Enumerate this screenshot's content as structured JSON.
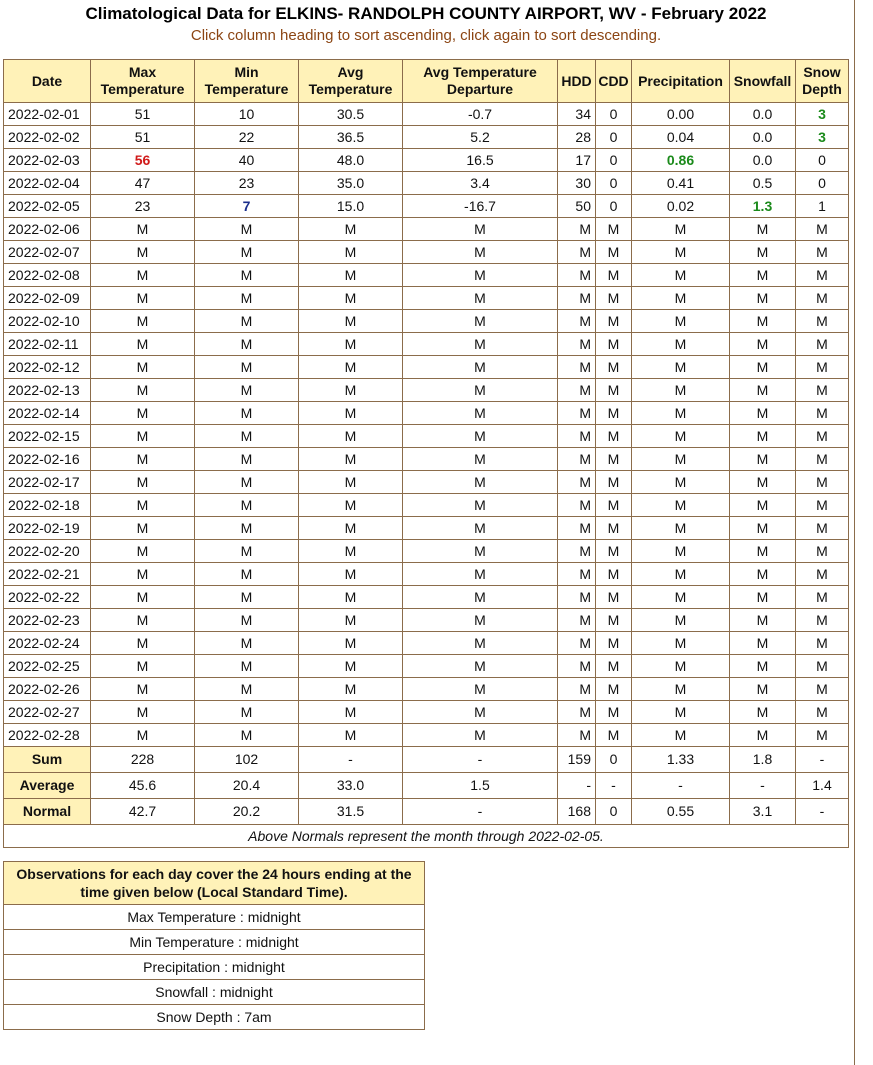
{
  "page": {
    "title": "Climatological Data for ELKINS- RANDOLPH COUNTY AIRPORT, WV - February 2022",
    "subtitle": "Click column heading to sort ascending, click again to sort descending."
  },
  "colors": {
    "header_bg": "#fff2b8",
    "border": "#8b6c4b",
    "subtitle": "#8b4513",
    "record_high": "#d11a1a",
    "record_low": "#1a2e8c",
    "max_green": "#1b8a1b"
  },
  "table": {
    "headers": [
      {
        "key": "date",
        "label": "Date"
      },
      {
        "key": "max",
        "label": "Max Temperature"
      },
      {
        "key": "min",
        "label": "Min Temperature"
      },
      {
        "key": "avg",
        "label": "Avg Temperature"
      },
      {
        "key": "dep",
        "label": "Avg Temperature Departure"
      },
      {
        "key": "hdd",
        "label": "HDD"
      },
      {
        "key": "cdd",
        "label": "CDD"
      },
      {
        "key": "precip",
        "label": "Precipitation"
      },
      {
        "key": "snow",
        "label": "Snowfall"
      },
      {
        "key": "depth",
        "label": "Snow Depth"
      }
    ],
    "rows": [
      [
        "2022-02-01",
        "51",
        "10",
        "30.5",
        "-0.7",
        "34",
        "0",
        "0.00",
        "0.0",
        "3"
      ],
      [
        "2022-02-02",
        "51",
        "22",
        "36.5",
        "5.2",
        "28",
        "0",
        "0.04",
        "0.0",
        "3"
      ],
      [
        "2022-02-03",
        "56",
        "40",
        "48.0",
        "16.5",
        "17",
        "0",
        "0.86",
        "0.0",
        "0"
      ],
      [
        "2022-02-04",
        "47",
        "23",
        "35.0",
        "3.4",
        "30",
        "0",
        "0.41",
        "0.5",
        "0"
      ],
      [
        "2022-02-05",
        "23",
        "7",
        "15.0",
        "-16.7",
        "50",
        "0",
        "0.02",
        "1.3",
        "1"
      ],
      [
        "2022-02-06",
        "M",
        "M",
        "M",
        "M",
        "M",
        "M",
        "M",
        "M",
        "M"
      ],
      [
        "2022-02-07",
        "M",
        "M",
        "M",
        "M",
        "M",
        "M",
        "M",
        "M",
        "M"
      ],
      [
        "2022-02-08",
        "M",
        "M",
        "M",
        "M",
        "M",
        "M",
        "M",
        "M",
        "M"
      ],
      [
        "2022-02-09",
        "M",
        "M",
        "M",
        "M",
        "M",
        "M",
        "M",
        "M",
        "M"
      ],
      [
        "2022-02-10",
        "M",
        "M",
        "M",
        "M",
        "M",
        "M",
        "M",
        "M",
        "M"
      ],
      [
        "2022-02-11",
        "M",
        "M",
        "M",
        "M",
        "M",
        "M",
        "M",
        "M",
        "M"
      ],
      [
        "2022-02-12",
        "M",
        "M",
        "M",
        "M",
        "M",
        "M",
        "M",
        "M",
        "M"
      ],
      [
        "2022-02-13",
        "M",
        "M",
        "M",
        "M",
        "M",
        "M",
        "M",
        "M",
        "M"
      ],
      [
        "2022-02-14",
        "M",
        "M",
        "M",
        "M",
        "M",
        "M",
        "M",
        "M",
        "M"
      ],
      [
        "2022-02-15",
        "M",
        "M",
        "M",
        "M",
        "M",
        "M",
        "M",
        "M",
        "M"
      ],
      [
        "2022-02-16",
        "M",
        "M",
        "M",
        "M",
        "M",
        "M",
        "M",
        "M",
        "M"
      ],
      [
        "2022-02-17",
        "M",
        "M",
        "M",
        "M",
        "M",
        "M",
        "M",
        "M",
        "M"
      ],
      [
        "2022-02-18",
        "M",
        "M",
        "M",
        "M",
        "M",
        "M",
        "M",
        "M",
        "M"
      ],
      [
        "2022-02-19",
        "M",
        "M",
        "M",
        "M",
        "M",
        "M",
        "M",
        "M",
        "M"
      ],
      [
        "2022-02-20",
        "M",
        "M",
        "M",
        "M",
        "M",
        "M",
        "M",
        "M",
        "M"
      ],
      [
        "2022-02-21",
        "M",
        "M",
        "M",
        "M",
        "M",
        "M",
        "M",
        "M",
        "M"
      ],
      [
        "2022-02-22",
        "M",
        "M",
        "M",
        "M",
        "M",
        "M",
        "M",
        "M",
        "M"
      ],
      [
        "2022-02-23",
        "M",
        "M",
        "M",
        "M",
        "M",
        "M",
        "M",
        "M",
        "M"
      ],
      [
        "2022-02-24",
        "M",
        "M",
        "M",
        "M",
        "M",
        "M",
        "M",
        "M",
        "M"
      ],
      [
        "2022-02-25",
        "M",
        "M",
        "M",
        "M",
        "M",
        "M",
        "M",
        "M",
        "M"
      ],
      [
        "2022-02-26",
        "M",
        "M",
        "M",
        "M",
        "M",
        "M",
        "M",
        "M",
        "M"
      ],
      [
        "2022-02-27",
        "M",
        "M",
        "M",
        "M",
        "M",
        "M",
        "M",
        "M",
        "M"
      ],
      [
        "2022-02-28",
        "M",
        "M",
        "M",
        "M",
        "M",
        "M",
        "M",
        "M",
        "M"
      ]
    ],
    "highlights": [
      {
        "row": 0,
        "col": 9,
        "style": "green"
      },
      {
        "row": 1,
        "col": 9,
        "style": "green"
      },
      {
        "row": 2,
        "col": 1,
        "style": "red"
      },
      {
        "row": 2,
        "col": 7,
        "style": "green"
      },
      {
        "row": 4,
        "col": 2,
        "style": "blue"
      },
      {
        "row": 4,
        "col": 8,
        "style": "green"
      }
    ],
    "summary": [
      {
        "label": "Sum",
        "values": [
          "228",
          "102",
          "-",
          "-",
          "159",
          "0",
          "1.33",
          "1.8",
          "-"
        ]
      },
      {
        "label": "Average",
        "values": [
          "45.6",
          "20.4",
          "33.0",
          "1.5",
          "-",
          "-",
          "-",
          "-",
          "1.4"
        ]
      },
      {
        "label": "Normal",
        "values": [
          "42.7",
          "20.2",
          "31.5",
          "-",
          "168",
          "0",
          "0.55",
          "3.1",
          "-"
        ]
      }
    ],
    "note": "Above Normals represent the month through 2022-02-05."
  },
  "observations": {
    "heading": "Observations for each day cover the 24 hours ending at the time given below (Local Standard Time).",
    "items": [
      "Max Temperature : midnight",
      "Min Temperature : midnight",
      "Precipitation : midnight",
      "Snowfall : midnight",
      "Snow Depth : 7am"
    ]
  }
}
